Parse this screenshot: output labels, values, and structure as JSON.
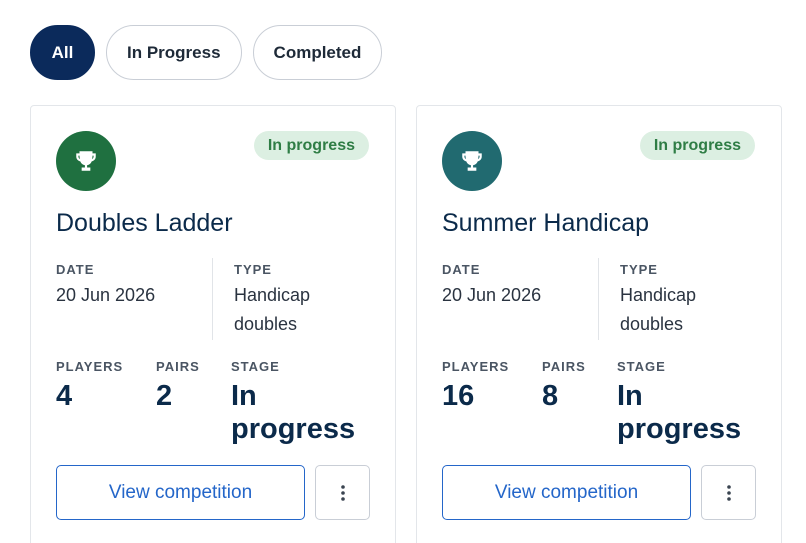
{
  "filters": [
    {
      "label": "All",
      "active": true
    },
    {
      "label": "In Progress",
      "active": false
    },
    {
      "label": "Completed",
      "active": false
    }
  ],
  "labels": {
    "date": "DATE",
    "type": "TYPE",
    "players": "PLAYERS",
    "pairs": "PAIRS",
    "stage": "STAGE",
    "view": "View competition"
  },
  "competitions": [
    {
      "icon": "trophy-icon",
      "icon_color": "#1f7040",
      "status": "In progress",
      "title": "Doubles Ladder",
      "date": "20 Jun 2026",
      "type_line1": "Handicap",
      "type_line2": "doubles",
      "players": "4",
      "pairs": "2",
      "stage_line1": "In",
      "stage_line2": "progress"
    },
    {
      "icon": "trophy-icon",
      "icon_color": "#216a70",
      "status": "In progress",
      "title": "Summer Handicap",
      "date": "20 Jun 2026",
      "type_line1": "Handicap",
      "type_line2": "doubles",
      "players": "16",
      "pairs": "8",
      "stage_line1": "In",
      "stage_line2": "progress"
    }
  ],
  "colors": {
    "primary": "#0b2a5b",
    "link": "#2466c9",
    "badge_bg": "#dcefe2",
    "badge_text": "#2f7d45"
  }
}
